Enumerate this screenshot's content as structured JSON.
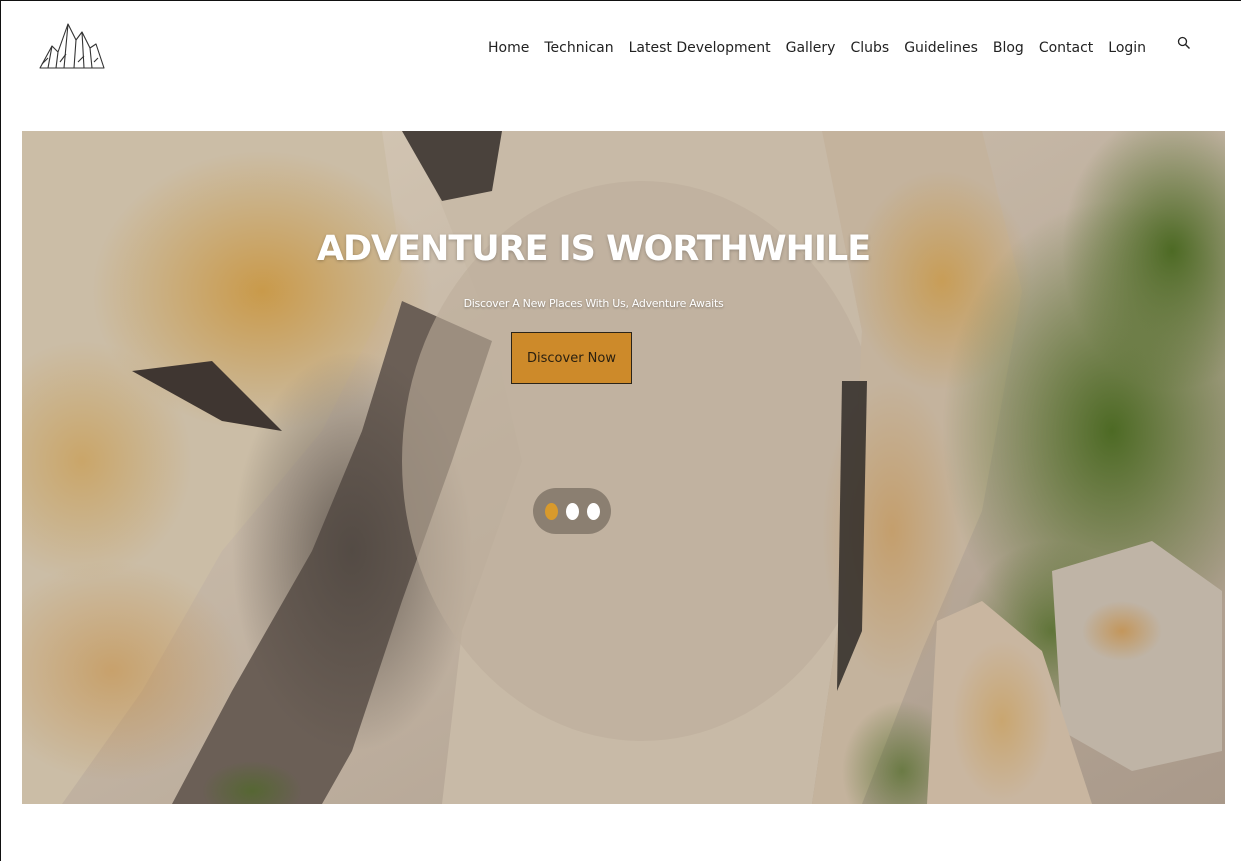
{
  "header": {
    "logo_icon": "mountain-logo-icon",
    "nav": [
      {
        "label": "Home"
      },
      {
        "label": "Technican"
      },
      {
        "label": "Latest Development"
      },
      {
        "label": "Gallery"
      },
      {
        "label": "Clubs"
      },
      {
        "label": "Guidelines"
      },
      {
        "label": "Blog"
      },
      {
        "label": "Contact"
      },
      {
        "label": "Login"
      }
    ],
    "search_icon": "search-icon"
  },
  "hero": {
    "title": "ADVENTURE IS WORTHWHILE",
    "subtitle": "Discover A New Places With Us, Adventure Awaits",
    "cta_label": "Discover Now",
    "slides": 3,
    "active_slide": 1,
    "colors": {
      "cta": "#cd8a2a",
      "active_dot": "#d89a2c"
    }
  }
}
